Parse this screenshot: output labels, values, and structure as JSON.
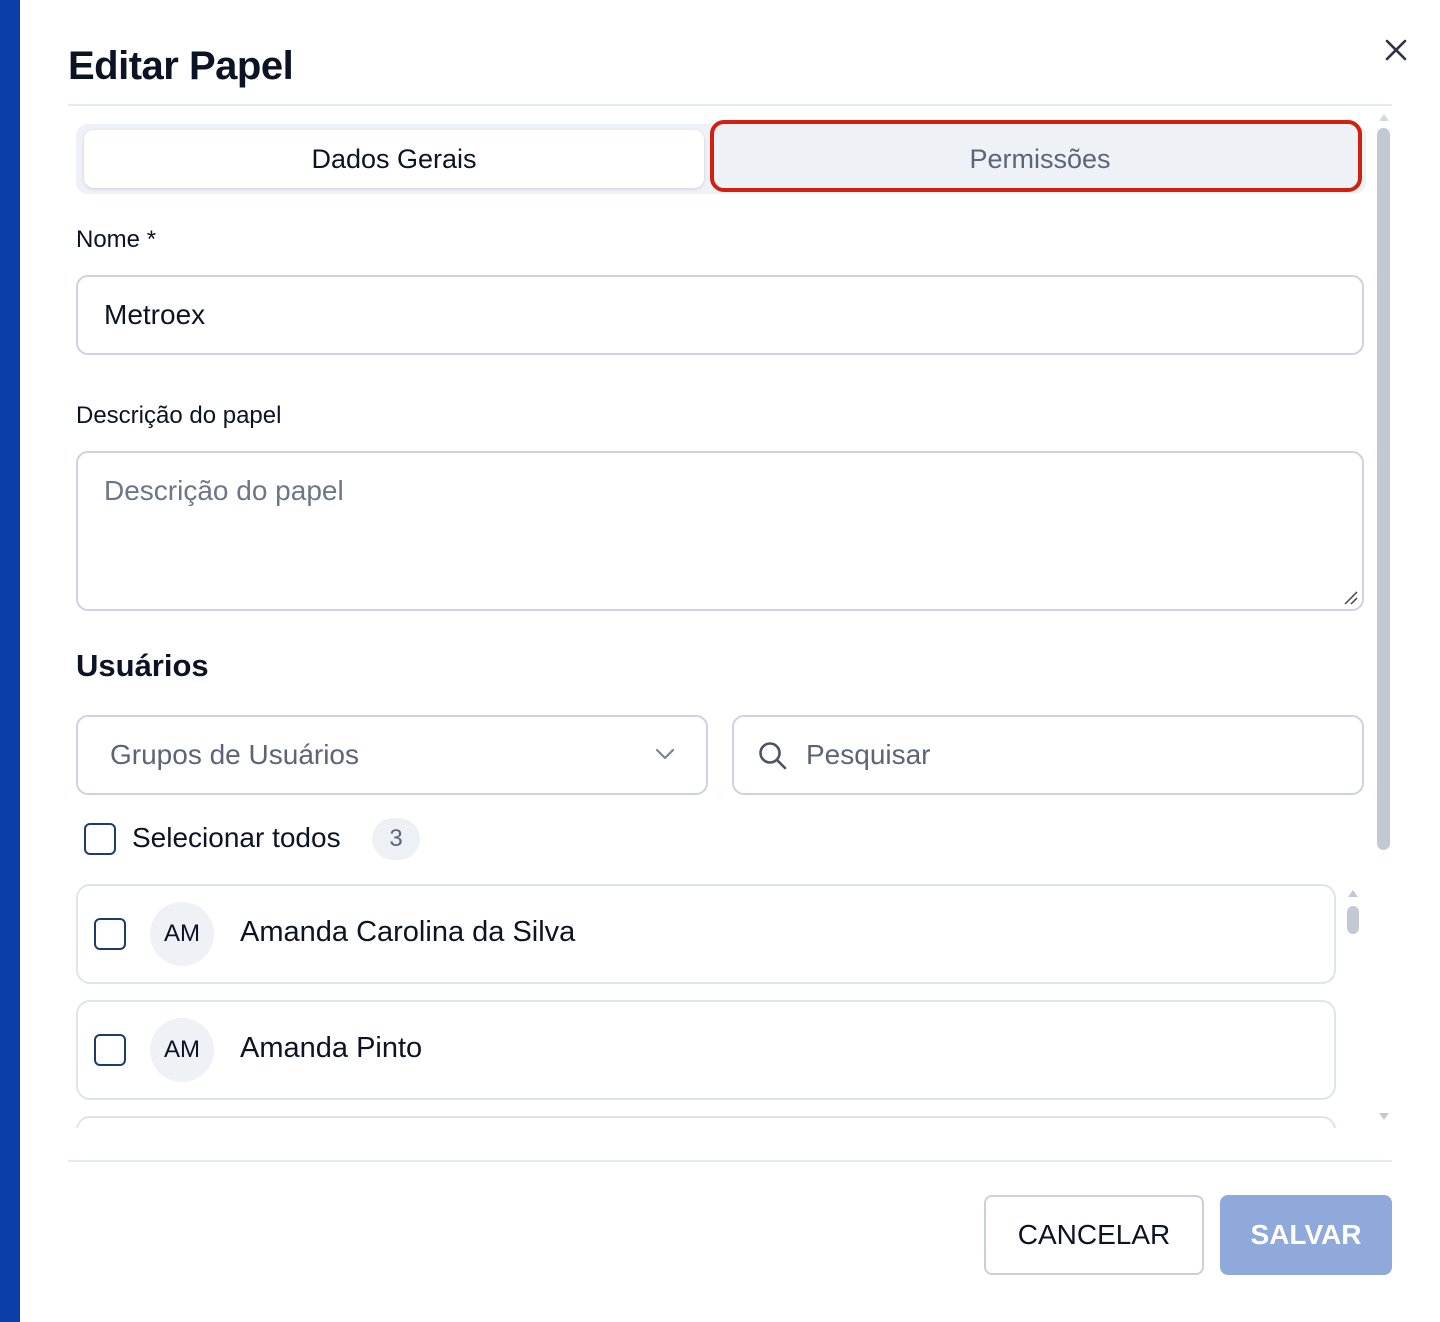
{
  "dialog": {
    "title": "Editar Papel",
    "close_icon": "close-icon"
  },
  "tabs": [
    {
      "label": "Dados Gerais",
      "active": true
    },
    {
      "label": "Permissões",
      "active": false
    }
  ],
  "form": {
    "name_label": "Nome *",
    "name_value": "Metroex",
    "description_label": "Descrição do papel",
    "description_placeholder": "Descrição do papel"
  },
  "users": {
    "section_title": "Usuários",
    "group_select_placeholder": "Grupos de Usuários",
    "search_placeholder": "Pesquisar",
    "select_all_label": "Selecionar todos",
    "total_count": "3",
    "items": [
      {
        "initials": "AM",
        "name": "Amanda Carolina da Silva",
        "checked": false
      },
      {
        "initials": "AM",
        "name": "Amanda Pinto",
        "checked": false
      }
    ]
  },
  "footer": {
    "cancel_label": "CANCELAR",
    "save_label": "SALVAR"
  },
  "colors": {
    "accent": "#0a3ea8",
    "highlight": "#d21f0f",
    "save_disabled": "#8fa9db"
  }
}
